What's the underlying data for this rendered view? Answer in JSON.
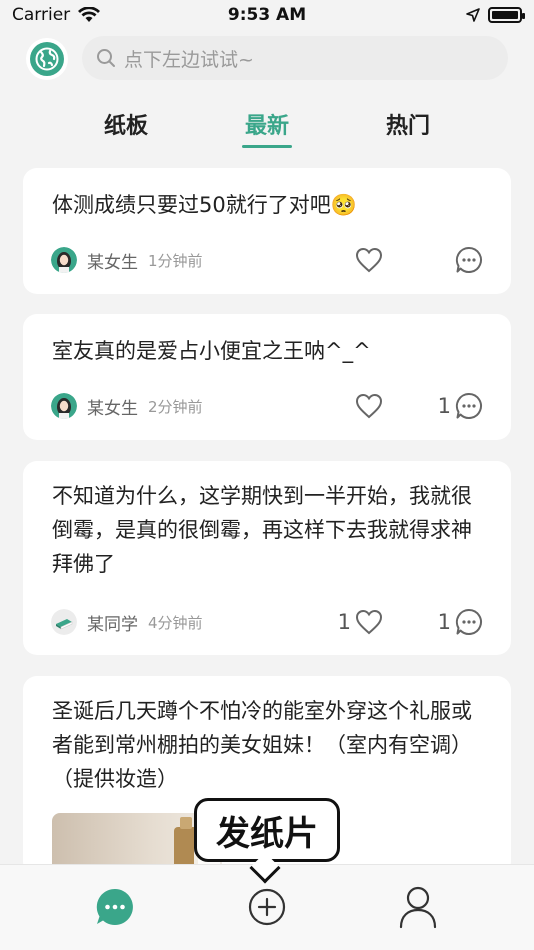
{
  "status_bar": {
    "carrier": "Carrier",
    "time": "9:53 AM"
  },
  "search": {
    "placeholder": "点下左边试试~"
  },
  "tabs": [
    {
      "label": "纸板",
      "active": false
    },
    {
      "label": "最新",
      "active": true
    },
    {
      "label": "热门",
      "active": false
    }
  ],
  "posts": [
    {
      "text": "体测成绩只要过50就行了对吧🥺",
      "author": "某女生",
      "time": "1分钟前",
      "likes": "",
      "comments": "",
      "avatar": "girl-avatar"
    },
    {
      "text": "室友真的是爱占小便宜之王呐^_^",
      "author": "某女生",
      "time": "2分钟前",
      "likes": "",
      "comments": "1",
      "avatar": "girl-avatar"
    },
    {
      "text": "不知道为什么，这学期快到一半开始，我就很倒霉，是真的很倒霉，再这样下去我就得求神拜佛了",
      "author": "某同学",
      "time": "4分钟前",
      "likes": "1",
      "comments": "1",
      "avatar": "book-avatar"
    },
    {
      "text": "圣诞后几天蹲个不怕冷的能室外穿这个礼服或者能到常州棚拍的美女姐妹！（室内有空调）（提供妆造）",
      "author": "",
      "time": "",
      "likes": "",
      "comments": "",
      "avatar": ""
    }
  ],
  "tooltip": {
    "label": "发纸片"
  },
  "bottom_nav": [
    {
      "icon": "chat-bubble-icon",
      "active": true
    },
    {
      "icon": "add-circle-icon",
      "active": false
    },
    {
      "icon": "person-icon",
      "active": false
    }
  ],
  "colors": {
    "accent": "#3aa68a",
    "background": "#f3f3f3",
    "card": "#ffffff"
  }
}
